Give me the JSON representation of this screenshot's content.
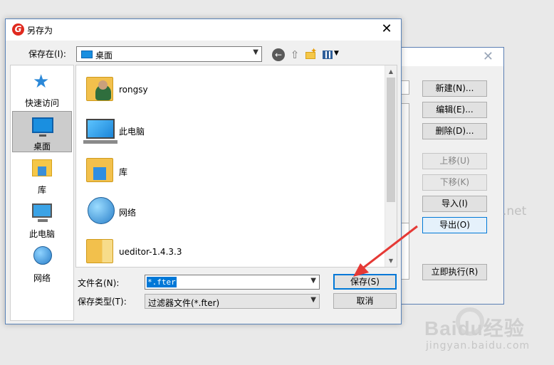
{
  "dialog": {
    "title": "另存为",
    "app_icon_glyph": "G",
    "close_glyph": "✕",
    "save_in_label": "保存在(I):",
    "save_in_value": "桌面",
    "places": [
      {
        "label": "快速访问",
        "icon": "star-icon"
      },
      {
        "label": "桌面",
        "icon": "desktop-icon"
      },
      {
        "label": "库",
        "icon": "library-icon"
      },
      {
        "label": "此电脑",
        "icon": "computer-icon"
      },
      {
        "label": "网络",
        "icon": "network-icon"
      }
    ],
    "files": [
      {
        "name": "rongsy",
        "icon": "user-folder-icon"
      },
      {
        "name": "此电脑",
        "icon": "computer-icon"
      },
      {
        "name": "库",
        "icon": "library-folder-icon"
      },
      {
        "name": "网络",
        "icon": "network-icon"
      },
      {
        "name": "ueditor-1.4.3.3",
        "icon": "folder-icon"
      }
    ],
    "file_name_label": "文件名(N):",
    "file_name_value": "*.fter",
    "file_type_label": "保存类型(T):",
    "file_type_value": "过滤器文件(*.fter)",
    "save_button": "保存(S)",
    "cancel_button": "取消"
  },
  "background_dialog": {
    "close_glyph": "✕",
    "buttons": [
      {
        "label": "新建(N)...",
        "enabled": true
      },
      {
        "label": "编辑(E)...",
        "enabled": true
      },
      {
        "label": "删除(D)...",
        "enabled": true
      },
      {
        "label": "上移(U)",
        "enabled": false
      },
      {
        "label": "下移(K)",
        "enabled": false
      },
      {
        "label": "导入(I)",
        "enabled": true
      },
      {
        "label": "导出(O)",
        "enabled": true
      },
      {
        "label": "立即执行(R)",
        "enabled": true
      }
    ]
  },
  "watermark": {
    "brand": "Baidu经验",
    "url": "jingyan.baidu.com",
    "fragment": ".net"
  },
  "colors": {
    "accent": "#0078d7",
    "annotation_arrow": "#e53935"
  }
}
